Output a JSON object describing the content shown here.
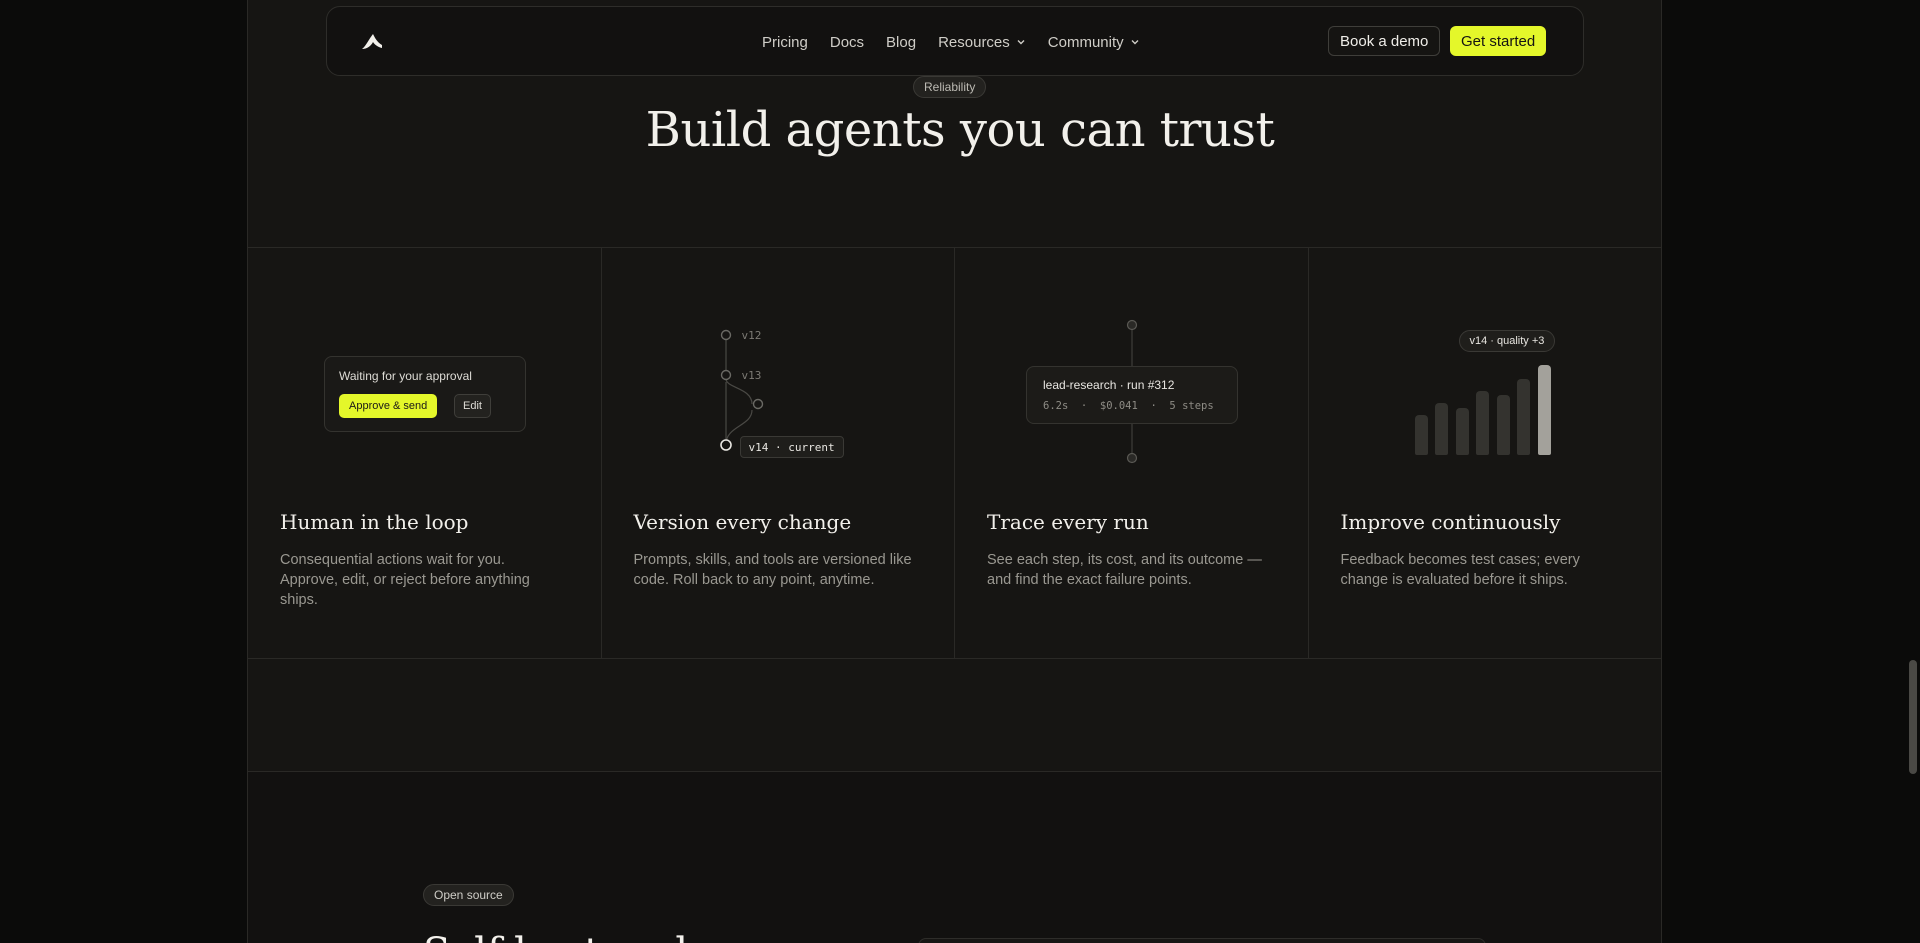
{
  "nav": {
    "links": [
      {
        "label": "Pricing"
      },
      {
        "label": "Docs"
      },
      {
        "label": "Blog"
      },
      {
        "label": "Resources"
      },
      {
        "label": "Community"
      }
    ],
    "book_demo": "Book a demo",
    "get_started": "Get started"
  },
  "section": {
    "pill": "Reliability",
    "title": "Build agents you can trust"
  },
  "cards": [
    {
      "title": "Human in the loop",
      "desc": "Consequential actions wait for you. Approve, edit, or reject before anything ships.",
      "visual": {
        "text": "Waiting for your approval",
        "approve": "Approve & send",
        "edit": "Edit"
      }
    },
    {
      "title": "Version every change",
      "desc": "Prompts, skills, and tools are versioned like code. Roll back to any point, anytime.",
      "visual": {
        "v12": "v12",
        "v13": "v13",
        "current": "v14 · current"
      }
    },
    {
      "title": "Trace every run",
      "desc": "See each step, its cost, and its outcome — and find the exact failure points.",
      "visual": {
        "title": "lead-research · run #312",
        "meta": "6.2s  ·  $0.041  ·  5 steps"
      }
    },
    {
      "title": "Improve continuously",
      "desc": "Feedback becomes test cases; every change is evaluated before it ships.",
      "visual": {
        "badge": "v14 · quality +3",
        "bars": [
          0.44,
          0.58,
          0.52,
          0.71,
          0.67,
          0.84,
          1.0
        ]
      }
    }
  ],
  "next_section": {
    "pill": "Open source",
    "title_partial": "Self-host and"
  },
  "colors": {
    "accent": "#e4f72a",
    "background": "#161513",
    "border": "#2a2926"
  }
}
